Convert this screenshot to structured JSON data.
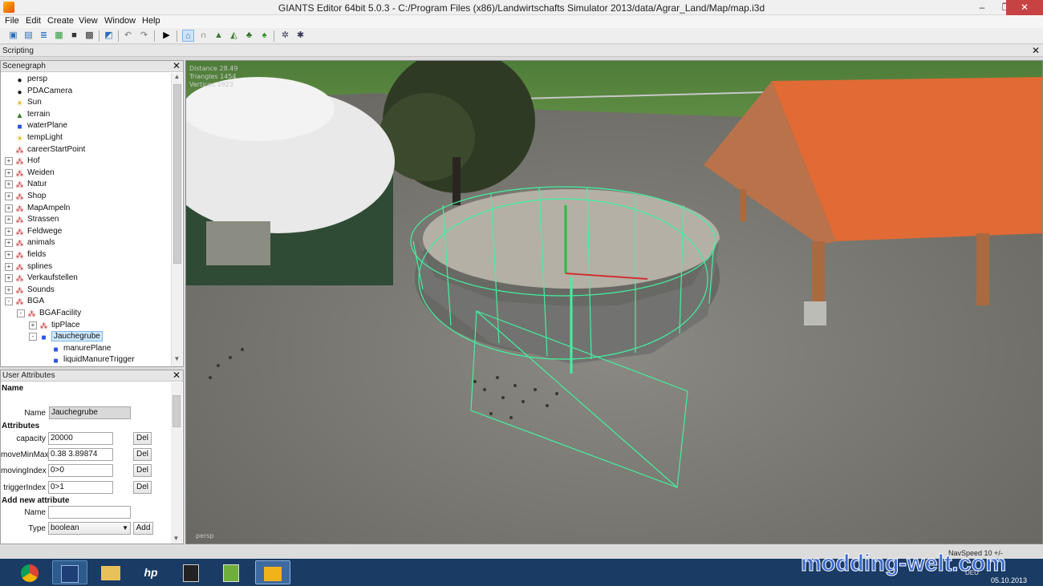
{
  "window": {
    "title": "GIANTS Editor 64bit 5.0.3 - C:/Program Files (x86)/Landwirtschafts Simulator 2013/data/Agrar_Land/Map/map.i3d",
    "controls": [
      "–",
      "❐",
      "✕"
    ]
  },
  "menu": [
    "File",
    "Edit",
    "Create",
    "View",
    "Window",
    "Help"
  ],
  "toolbar_icons": [
    "new-file-icon",
    "open-file-icon",
    "open-list-icon",
    "refresh-icon",
    "save-icon",
    "save-all-icon",
    "import-icon",
    "undo-icon",
    "redo-icon",
    "play-icon",
    "select-icon",
    "move-icon",
    "terrain-icon",
    "terrain-paint-icon",
    "foliage-icon",
    "grass-icon",
    "settings-icon",
    "scripts-icon"
  ],
  "scripting": {
    "label": "Scripting"
  },
  "scenegraph": {
    "title": "Scenegraph",
    "nodes": [
      {
        "label": "persp",
        "icon": "camera",
        "depth": 0,
        "expander": ""
      },
      {
        "label": "PDACamera",
        "icon": "camera",
        "depth": 0,
        "expander": ""
      },
      {
        "label": "Sun",
        "icon": "light",
        "depth": 0,
        "expander": ""
      },
      {
        "label": "terrain",
        "icon": "terrain",
        "depth": 0,
        "expander": ""
      },
      {
        "label": "waterPlane",
        "icon": "shape",
        "depth": 0,
        "expander": ""
      },
      {
        "label": "tempLight",
        "icon": "light",
        "depth": 0,
        "expander": ""
      },
      {
        "label": "careerStartPoint",
        "icon": "group",
        "depth": 0,
        "expander": ""
      },
      {
        "label": "Hof",
        "icon": "group",
        "depth": 0,
        "expander": "+"
      },
      {
        "label": "Weiden",
        "icon": "group",
        "depth": 0,
        "expander": "+"
      },
      {
        "label": "Natur",
        "icon": "group",
        "depth": 0,
        "expander": "+"
      },
      {
        "label": "Shop",
        "icon": "group",
        "depth": 0,
        "expander": "+"
      },
      {
        "label": "MapAmpeln",
        "icon": "group",
        "depth": 0,
        "expander": "+"
      },
      {
        "label": "Strassen",
        "icon": "group",
        "depth": 0,
        "expander": "+"
      },
      {
        "label": "Feldwege",
        "icon": "group",
        "depth": 0,
        "expander": "+"
      },
      {
        "label": "animals",
        "icon": "group",
        "depth": 0,
        "expander": "+"
      },
      {
        "label": "fields",
        "icon": "group",
        "depth": 0,
        "expander": "+"
      },
      {
        "label": "splines",
        "icon": "group",
        "depth": 0,
        "expander": "+"
      },
      {
        "label": "Verkaufstellen",
        "icon": "group",
        "depth": 0,
        "expander": "+"
      },
      {
        "label": "Sounds",
        "icon": "group",
        "depth": 0,
        "expander": "+"
      },
      {
        "label": "BGA",
        "icon": "group",
        "depth": 0,
        "expander": "-"
      },
      {
        "label": "BGAFacility",
        "icon": "group",
        "depth": 1,
        "expander": "-"
      },
      {
        "label": "tipPlace",
        "icon": "group",
        "depth": 2,
        "expander": "+"
      },
      {
        "label": "Jauchegrube",
        "icon": "shape",
        "depth": 2,
        "expander": "-",
        "selected": true
      },
      {
        "label": "manurePlane",
        "icon": "shape",
        "depth": 3,
        "expander": ""
      },
      {
        "label": "liquidManureTrigger",
        "icon": "shape",
        "depth": 3,
        "expander": ""
      }
    ]
  },
  "user_attributes": {
    "title": "User Attributes",
    "name_section": "Name",
    "name_label": "Name",
    "name_value": "Jauchegrube",
    "attributes_section": "Attributes",
    "attributes": [
      {
        "label": "capacity",
        "value": "20000",
        "button": "Del"
      },
      {
        "label": "moveMinMaxY",
        "value": "0.38 3.89874",
        "button": "Del"
      },
      {
        "label": "movingIndex",
        "value": "0>0",
        "button": "Del"
      },
      {
        "label": "triggerIndex",
        "value": "0>1",
        "button": "Del"
      }
    ],
    "add_section": "Add new attribute",
    "add_name_label": "Name",
    "add_name_value": "",
    "type_label": "Type",
    "type_value": "boolean",
    "add_button": "Add"
  },
  "viewport": {
    "stats": [
      "Distance 28.49",
      "Triangles 1454",
      "Vertices 1923"
    ],
    "camera_label": "persp",
    "nav_speed": "NavSpeed 10 +/-"
  },
  "taskbar": {
    "apps": [
      "chrome-icon",
      "save-disk-icon",
      "explorer-icon",
      "hp-icon",
      "touch-icon",
      "taskmgr-icon",
      "giants-editor-icon"
    ],
    "watermark": "modding-welt.com",
    "date": "05.10.2013",
    "lang": "DEU"
  },
  "colors": {
    "selection": "#cde8ff",
    "wireframe": "#41f2a0",
    "taskbar": "#1a3b63",
    "roof": "#e8632c"
  }
}
